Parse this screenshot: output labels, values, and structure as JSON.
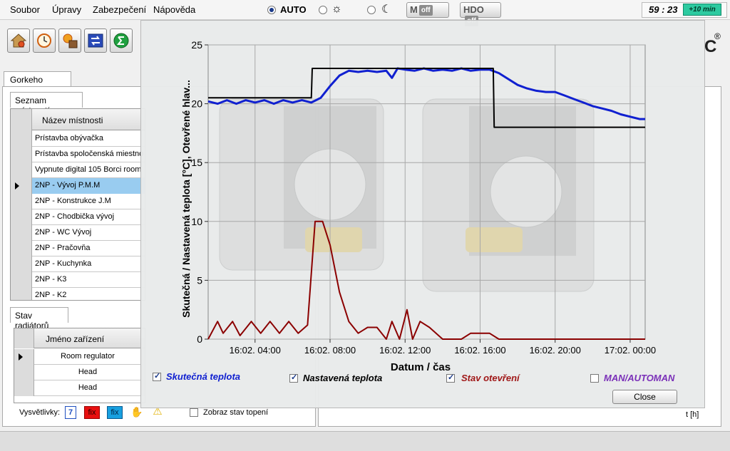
{
  "menu": {
    "items": [
      "Soubor",
      "Úpravy",
      "Zabezpečení",
      "Nápověda"
    ],
    "mode_auto": "AUTO",
    "toggle_man_letter": "M",
    "toggle_man_state": "off",
    "toggle_hdo_label": "HDO",
    "toggle_hdo_state": "off",
    "clock": "59 : 23",
    "plus_button": "+10 min"
  },
  "toolbar": {
    "icons": [
      "house-gear-icon",
      "clock-icon",
      "sun-house-icon",
      "sync-arrows-icon",
      "sum-icon"
    ]
  },
  "left": {
    "outer_tab": "Gorkeho Skalica",
    "rooms_tab": "Seznam místností",
    "rooms_header": "Název místnosti",
    "rooms": [
      "Prístavba obývačka",
      "Prístavba spoločenská miestno",
      "Vypnute digital 105 Borci room",
      "2NP - Vývoj P.M.M",
      "2NP - Konstrukce J.M",
      "2NP - Chodbička vývoj",
      "2NP - WC Vývoj",
      "2NP - Pračovňa",
      "2NP - Kuchynka",
      "2NP - K3",
      "2NP - K2"
    ],
    "selected_room_index": 3,
    "devices_tab": "Stav radiátorů",
    "devices_header": "Jméno zařízení",
    "devices": [
      "Room regulator",
      "Head",
      "Head"
    ],
    "legend_label": "Vysvětlivky:",
    "legend_items": [
      {
        "icon": "calendar-7-icon",
        "text": "7",
        "color": "#2050c0"
      },
      {
        "icon": "fix-red-icon",
        "text": "fix",
        "color": "#e81010"
      },
      {
        "icon": "fix-blue-icon",
        "text": "fix",
        "color": "#18a0e0"
      },
      {
        "icon": "hand-icon",
        "text": ""
      },
      {
        "icon": "warning-icon",
        "text": ""
      }
    ],
    "show_heating_label": "Zobraz  stav topení"
  },
  "right": {
    "brand_letter": "C",
    "brand_mark": "®",
    "t_axis_label": "t [h]"
  },
  "chart_data": {
    "type": "line",
    "ylabel": "Skutečná / Nastavená teplota [°C],  Otevřené hlav...",
    "xlabel": "Datum / čas",
    "ylim": [
      0,
      25
    ],
    "yticks": [
      0,
      5,
      10,
      15,
      20,
      25
    ],
    "xlim": [
      1.5,
      24.8
    ],
    "xticks": [
      4,
      8,
      12,
      16,
      20,
      24
    ],
    "xtick_labels": [
      "16:02. 04:00",
      "16:02. 08:00",
      "16:02. 12:00",
      "16:02. 16:00",
      "16:02. 20:00",
      "17:02. 00:00"
    ],
    "grid": true,
    "series": [
      {
        "name": "Skutečná teplota",
        "color": "#1020d0",
        "checked": true,
        "x": [
          1.5,
          2.0,
          2.5,
          3.0,
          3.5,
          4.0,
          4.5,
          5.0,
          5.5,
          6.0,
          6.5,
          7.0,
          7.5,
          8.0,
          8.5,
          9.0,
          9.5,
          10.0,
          10.5,
          11.0,
          11.3,
          11.6,
          12.0,
          12.5,
          13.0,
          13.5,
          14.0,
          14.5,
          15.0,
          15.5,
          16.0,
          16.5,
          17.0,
          17.5,
          18.0,
          18.5,
          19.0,
          19.5,
          20.0,
          20.5,
          21.0,
          21.5,
          22.0,
          22.5,
          23.0,
          23.5,
          24.0,
          24.5,
          24.8
        ],
        "y": [
          20.2,
          20.0,
          20.3,
          20.0,
          20.3,
          20.1,
          20.3,
          20.0,
          20.3,
          20.1,
          20.3,
          20.1,
          20.5,
          21.5,
          22.4,
          22.8,
          22.7,
          22.8,
          22.7,
          22.8,
          22.2,
          23.0,
          22.9,
          22.8,
          23.0,
          22.8,
          22.9,
          22.8,
          23.0,
          22.8,
          22.9,
          22.9,
          22.6,
          22.1,
          21.6,
          21.3,
          21.1,
          21.0,
          21.0,
          20.7,
          20.4,
          20.1,
          19.8,
          19.6,
          19.4,
          19.1,
          18.9,
          18.7,
          18.7
        ]
      },
      {
        "name": "Nastavená teplota",
        "color": "#000000",
        "checked": true,
        "x": [
          1.5,
          7.0,
          7.05,
          16.7,
          16.75,
          24.8
        ],
        "y": [
          20.5,
          20.5,
          23.0,
          23.0,
          18.0,
          18.0
        ]
      },
      {
        "name": "Stav otevření",
        "color": "#8b0000",
        "checked": true,
        "x": [
          1.5,
          2.0,
          2.3,
          2.8,
          3.2,
          3.8,
          4.3,
          4.8,
          5.3,
          5.8,
          6.3,
          6.8,
          7.2,
          7.6,
          8.0,
          8.5,
          9.0,
          9.5,
          10.0,
          10.5,
          11.0,
          11.3,
          11.7,
          12.1,
          12.4,
          12.8,
          13.3,
          14.0,
          15.0,
          15.5,
          16.5,
          17.0,
          20.0,
          24.8
        ],
        "y": [
          0.0,
          1.5,
          0.5,
          1.5,
          0.3,
          1.5,
          0.5,
          1.5,
          0.5,
          1.5,
          0.5,
          1.2,
          10.0,
          10.0,
          8.0,
          4.0,
          1.5,
          0.5,
          1.0,
          1.0,
          0.0,
          1.5,
          0.0,
          2.5,
          0.0,
          1.5,
          1.0,
          0.0,
          0.0,
          0.5,
          0.5,
          0.0,
          0.0,
          0.0
        ]
      },
      {
        "name": "MAN/AUTOMAN",
        "color": "#7a2fb8",
        "checked": false,
        "x": [],
        "y": []
      }
    ]
  },
  "dialog": {
    "close_label": "Close"
  }
}
